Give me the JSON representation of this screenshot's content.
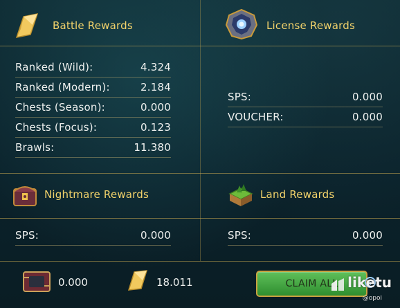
{
  "battle": {
    "title": "Battle Rewards",
    "rows": [
      {
        "label": "Ranked (Wild):",
        "value": "4.324"
      },
      {
        "label": "Ranked (Modern):",
        "value": "2.184"
      },
      {
        "label": "Chests (Season):",
        "value": "0.000"
      },
      {
        "label": "Chests (Focus):",
        "value": "0.123"
      },
      {
        "label": "Brawls:",
        "value": "11.380"
      }
    ]
  },
  "license": {
    "title": "License Rewards",
    "rows": [
      {
        "label": "SPS:",
        "value": "0.000"
      },
      {
        "label": "VOUCHER:",
        "value": "0.000"
      }
    ]
  },
  "nightmare": {
    "title": "Nightmare Rewards",
    "rows": [
      {
        "label": "SPS:",
        "value": "0.000"
      }
    ]
  },
  "land": {
    "title": "Land Rewards",
    "rows": [
      {
        "label": "SPS:",
        "value": "0.000"
      }
    ]
  },
  "footer": {
    "chip_value": "0.000",
    "sps_value": "18.011",
    "claim_label": "CLAIM ALL"
  },
  "watermark": {
    "brand": "liketu",
    "sub": "@opoi"
  },
  "colors": {
    "gold": "#f3d36b",
    "button_green": "#3f9f3a",
    "text": "#eef0ee"
  },
  "icons": {
    "battle": "gold-crystal-icon",
    "license": "license-crest-icon",
    "nightmare": "nightmare-chest-icon",
    "land": "land-island-icon",
    "chip": "chip-icon",
    "sps": "sps-crystal-icon",
    "watermark": "liketu-logo-icon",
    "info": "info-icon"
  }
}
